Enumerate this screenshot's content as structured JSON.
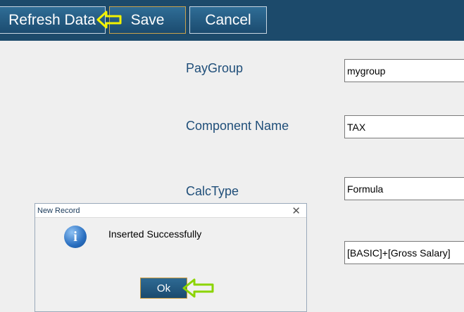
{
  "toolbar": {
    "refresh_label": "Refresh Data",
    "save_label": "Save",
    "cancel_label": "Cancel"
  },
  "form": {
    "paygroup_label": "PayGroup",
    "paygroup_value": "mygroup",
    "component_label": "Component Name",
    "component_value": "TAX",
    "calctype_label": "CalcType",
    "calctype_value": "Formula",
    "formula_value": "[BASIC]+[Gross Salary]"
  },
  "dialog": {
    "title": "New Record",
    "close_glyph": "✕",
    "message": "Inserted Successfully",
    "icon_glyph": "i",
    "ok_label": "Ok"
  },
  "icons": {
    "toolbar_pointer": "yellow-arrow-icon",
    "ok_pointer": "green-arrow-icon",
    "dialog_icon": "info-icon"
  },
  "colors": {
    "toolbar_bg": "#1c4a6b",
    "label_text": "#1f4e79",
    "pointer_yellow": "#f2f200",
    "pointer_green": "#8bd400"
  }
}
